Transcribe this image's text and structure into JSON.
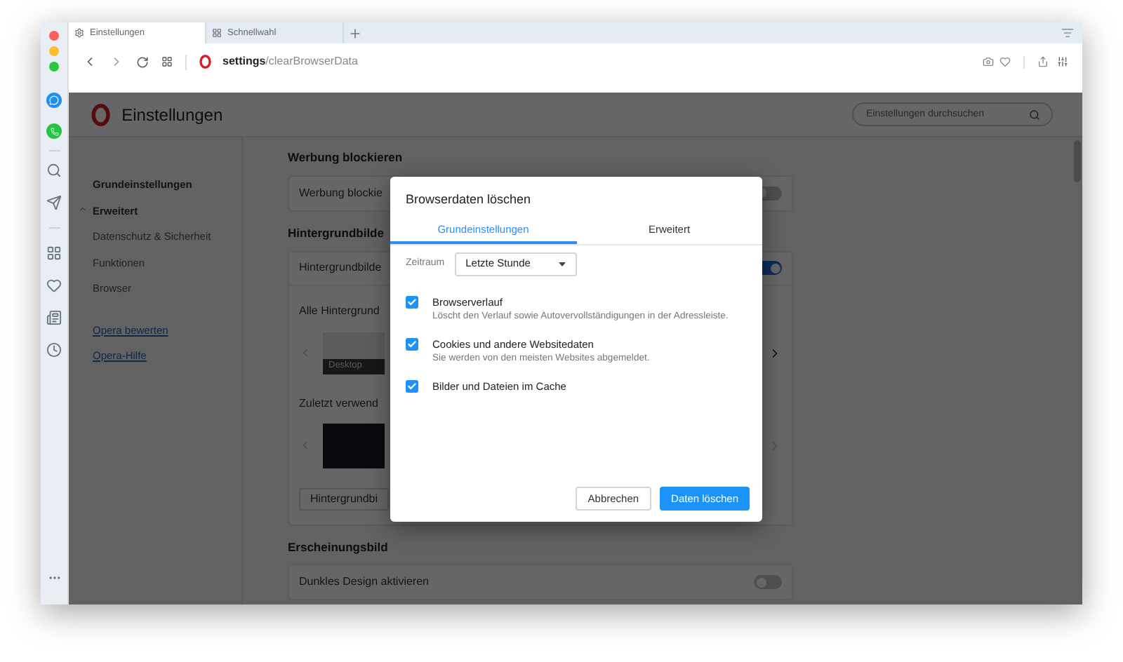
{
  "tabs": [
    {
      "label": "Einstellungen",
      "kind": "settings",
      "selected": true
    },
    {
      "label": "Schnellwahl",
      "kind": "speed-dial",
      "selected": false
    }
  ],
  "address_bar": {
    "host": "settings",
    "path": "/clearBrowserData"
  },
  "settings": {
    "title": "Einstellungen",
    "search": {
      "placeholder": "Einstellungen durchsuchen"
    },
    "nav": [
      {
        "label": "Grundeinstellungen",
        "kind": "heading"
      },
      {
        "label": "Erweitert",
        "kind": "group",
        "expanded": true
      },
      {
        "label": "Datenschutz & Sicherheit",
        "kind": "item"
      },
      {
        "label": "Funktionen",
        "kind": "item"
      },
      {
        "label": "Browser",
        "kind": "item"
      }
    ],
    "links": [
      "Opera bewerten",
      "Opera-Hilfe"
    ],
    "sections": [
      {
        "title": "Werbung blockieren",
        "rows": [
          {
            "kind": "toggle",
            "label": "Werbung blockie",
            "on": false
          }
        ]
      },
      {
        "title": "Hintergrundbilde",
        "rows": [
          {
            "kind": "toggle",
            "label": "Hintergrundbilde",
            "on": true
          },
          {
            "kind": "gallery",
            "label": "Alle Hintergrund",
            "thumb_label": "Desktop",
            "next_enabled": true
          },
          {
            "kind": "gallery",
            "label": "Zuletzt verwend",
            "next_enabled": false
          },
          {
            "kind": "button",
            "label": "Hintergrundbi"
          }
        ]
      },
      {
        "title": "Erscheinungsbild",
        "rows": [
          {
            "kind": "toggle",
            "label": "Dunkles Design aktivieren",
            "on": false
          }
        ]
      }
    ]
  },
  "dialog": {
    "title": "Browserdaten löschen",
    "tabs": [
      {
        "label": "Grundeinstellungen",
        "selected": true
      },
      {
        "label": "Erweitert",
        "selected": false
      }
    ],
    "time_range": {
      "label": "Zeitraum",
      "value": "Letzte Stunde"
    },
    "options": [
      {
        "title": "Browserverlauf",
        "description": "Löscht den Verlauf sowie Autovervollständigungen in der Adressleiste.",
        "checked": true
      },
      {
        "title": "Cookies und andere Websitedaten",
        "description": "Sie werden von den meisten Websites abgemeldet.",
        "checked": true
      },
      {
        "title": "Bilder und Dateien im Cache",
        "checked": true
      }
    ],
    "buttons": [
      {
        "label": "Abbrechen",
        "kind": "secondary"
      },
      {
        "label": "Daten löschen",
        "kind": "primary"
      }
    ]
  }
}
